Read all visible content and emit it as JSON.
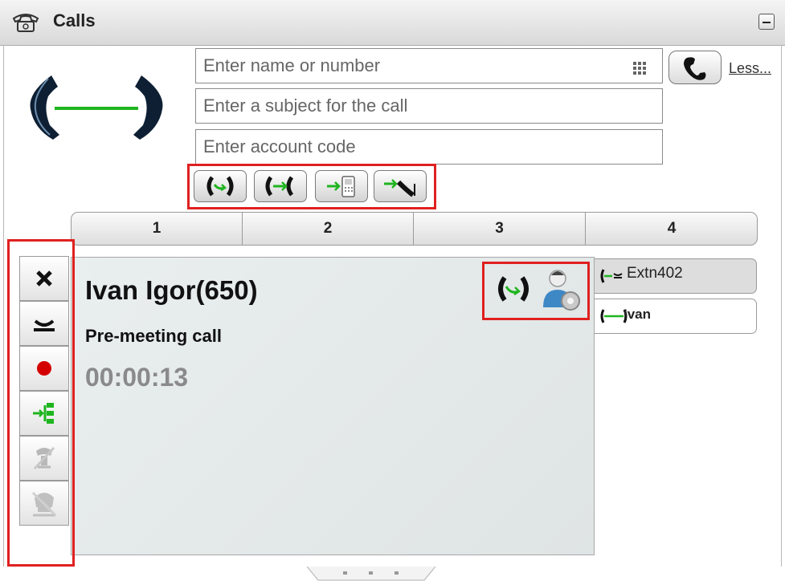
{
  "window": {
    "title": "Calls",
    "minimize_icon": "minimize-icon"
  },
  "dial": {
    "number_placeholder": "Enter name or number",
    "subject_placeholder": "Enter a subject for the call",
    "account_placeholder": "Enter account code",
    "less_label": "Less..."
  },
  "tabs": [
    "1",
    "2",
    "3",
    "4"
  ],
  "active_call": {
    "caller": "Ivan Igor(650)",
    "subject": "Pre-meeting call",
    "timer": "00:00:13"
  },
  "call_list": [
    {
      "label": "Extn402",
      "state": "held",
      "icon": "held-handset-icon"
    },
    {
      "label": "Ivan",
      "state": "connected",
      "icon": "connected-handset-icon"
    }
  ],
  "controls": [
    "drop-call",
    "hold",
    "record",
    "transfer",
    "mute-disabled",
    "listen-disabled"
  ],
  "colors": {
    "accent_green": "#1fb51f",
    "highlight_red": "#e02020",
    "record_red": "#d40000"
  }
}
